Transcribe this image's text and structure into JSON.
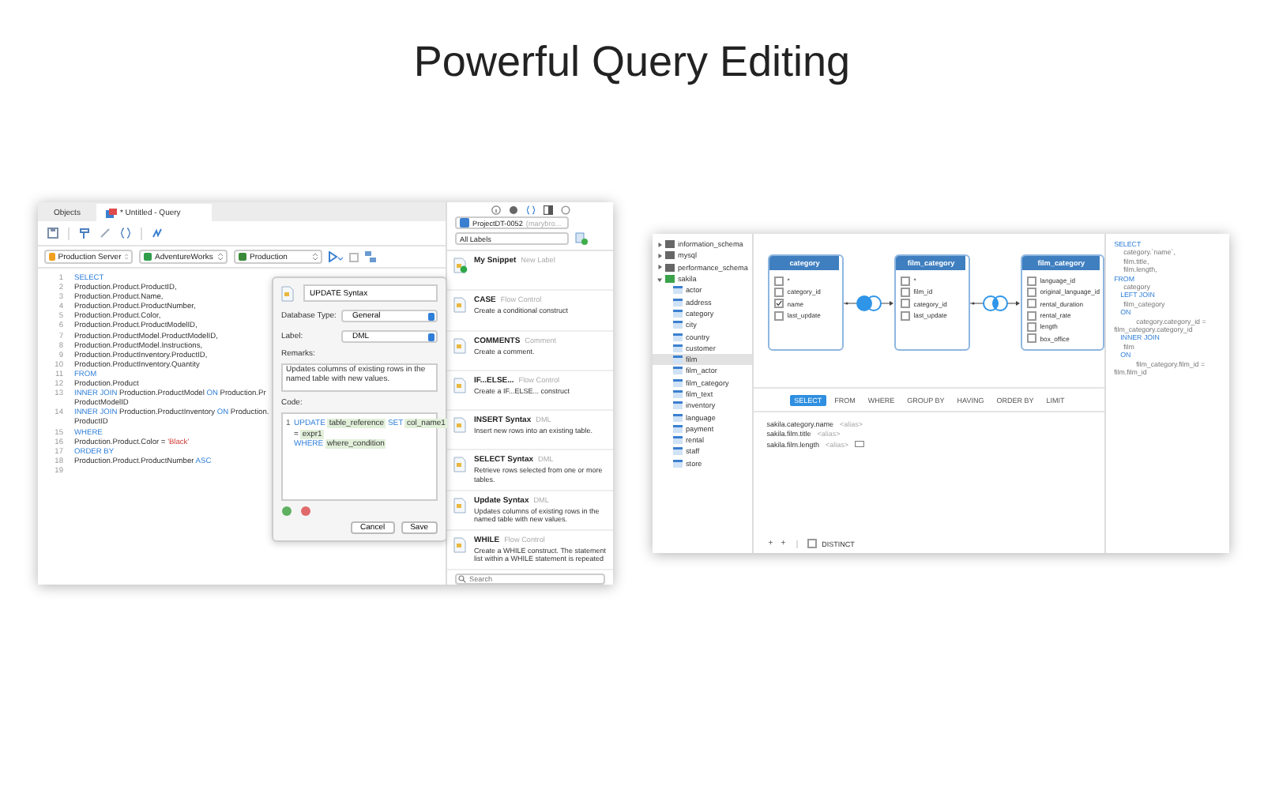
{
  "headline": "Powerful Query Editing",
  "query_window": {
    "tabs": [
      {
        "label": "Objects",
        "selected": false
      },
      {
        "label": "* Untitled - Query",
        "selected": true
      }
    ],
    "connection_selects": [
      {
        "label": "Production Server",
        "kind": "server"
      },
      {
        "label": "AdventureWorks",
        "kind": "database"
      },
      {
        "label": "Production",
        "kind": "schema"
      }
    ],
    "code_lines": [
      {
        "number": "1",
        "tokens": [
          {
            "text": "SELECT",
            "kind": "keyword"
          }
        ]
      },
      {
        "number": "2",
        "tokens": [
          {
            "text": "Production.Product.ProductID,",
            "kind": "plain"
          }
        ]
      },
      {
        "number": "3",
        "tokens": [
          {
            "text": "Production.Product.Name,",
            "kind": "plain"
          }
        ]
      },
      {
        "number": "4",
        "tokens": [
          {
            "text": "Production.Product.ProductNumber,",
            "kind": "plain"
          }
        ]
      },
      {
        "number": "5",
        "tokens": [
          {
            "text": "Production.Product.Color,",
            "kind": "plain"
          }
        ]
      },
      {
        "number": "6",
        "tokens": [
          {
            "text": "Production.Product.ProductModelID,",
            "kind": "plain"
          }
        ]
      },
      {
        "number": "7",
        "tokens": [
          {
            "text": "Production.ProductModel.ProductModelID,",
            "kind": "plain"
          }
        ]
      },
      {
        "number": "8",
        "tokens": [
          {
            "text": "Production.ProductModel.Instructions,",
            "kind": "plain"
          }
        ]
      },
      {
        "number": "9",
        "tokens": [
          {
            "text": "Production.ProductInventory.ProductID,",
            "kind": "plain"
          }
        ]
      },
      {
        "number": "10",
        "tokens": [
          {
            "text": "Production.ProductInventory.Quantity",
            "kind": "plain"
          }
        ]
      },
      {
        "number": "11",
        "tokens": [
          {
            "text": "FROM",
            "kind": "keyword"
          }
        ]
      },
      {
        "number": "12",
        "tokens": [
          {
            "text": "Production.Product",
            "kind": "plain"
          }
        ]
      },
      {
        "number": "13",
        "tokens": [
          {
            "text": "INNER JOIN",
            "kind": "keyword"
          },
          {
            "text": " Production.ProductModel ",
            "kind": "plain"
          },
          {
            "text": "ON",
            "kind": "keyword"
          },
          {
            "text": " Production.Pr",
            "kind": "plain"
          }
        ],
        "wrap": "ProductModelID"
      },
      {
        "number": "14",
        "tokens": [
          {
            "text": "INNER JOIN",
            "kind": "keyword"
          },
          {
            "text": " Production.ProductInventory ",
            "kind": "plain"
          },
          {
            "text": "ON",
            "kind": "keyword"
          },
          {
            "text": " Production.",
            "kind": "plain"
          }
        ],
        "wrap": "ProductID"
      },
      {
        "number": "15",
        "tokens": [
          {
            "text": "WHERE",
            "kind": "keyword"
          }
        ]
      },
      {
        "number": "16",
        "tokens": [
          {
            "text": "Production.Product.Color = ",
            "kind": "plain"
          },
          {
            "text": "'Black'",
            "kind": "string"
          }
        ]
      },
      {
        "number": "17",
        "tokens": [
          {
            "text": "ORDER BY",
            "kind": "keyword"
          }
        ]
      },
      {
        "number": "18",
        "tokens": [
          {
            "text": "Production.Product.ProductNumber ",
            "kind": "plain"
          },
          {
            "text": "ASC",
            "kind": "keyword"
          }
        ]
      },
      {
        "number": "19"
      }
    ],
    "snippet_editor": {
      "name": "UPDATE Syntax",
      "database_type": {
        "label": "Database Type:",
        "value": "General"
      },
      "label_field": {
        "label": "Label:",
        "value": "DML"
      },
      "remarks_label": "Remarks:",
      "remarks": "Updates columns of existing rows in the named table with new values.",
      "code_label": "Code:",
      "code_rows": [
        {
          "number": "1",
          "tokens": [
            {
              "text": "UPDATE",
              "kind": "keyword"
            },
            {
              "text": "table_reference",
              "kind": "placeholder"
            },
            {
              "text": "SET",
              "kind": "keyword"
            },
            {
              "text": "col_name1",
              "kind": "placeholder"
            }
          ]
        },
        {
          "tokens": [
            {
              "text": "=",
              "kind": "plain"
            },
            {
              "text": "expr1",
              "kind": "placeholder"
            }
          ]
        },
        {
          "tokens": [
            {
              "text": "WHERE",
              "kind": "keyword"
            },
            {
              "text": "where_condition",
              "kind": "placeholder"
            }
          ]
        }
      ],
      "buttons": [
        "Cancel",
        "Save"
      ]
    },
    "snippet_panel": {
      "project": "ProjectDT-0052",
      "project_owner": "(marybro...",
      "label_filter": "All Labels",
      "snippets": [
        {
          "name": "My Snippet",
          "label": "New Label",
          "kind": "user"
        },
        {
          "name": "CASE",
          "label": "Flow Control",
          "description": "Create a conditional construct",
          "kind": "builtin"
        },
        {
          "name": "COMMENTS",
          "label": "Comment",
          "description": "Create a comment.",
          "kind": "builtin"
        },
        {
          "name": "IF...ELSE...",
          "label": "Flow Control",
          "description": "Create a IF...ELSE... construct",
          "kind": "builtin"
        },
        {
          "name": "INSERT Syntax",
          "label": "DML",
          "description": "Insert new rows into an existing table.",
          "kind": "builtin"
        },
        {
          "name": "SELECT Syntax",
          "label": "DML",
          "description": "Retrieve rows selected from one or more tables.",
          "kind": "builtin"
        },
        {
          "name": "Update Syntax",
          "label": "DML",
          "description": "Updates columns of existing rows in the named table with new values.",
          "kind": "builtin"
        },
        {
          "name": "WHILE",
          "label": "Flow Control",
          "description": "Create a WHILE construct. The statement list within a WHILE statement is repeated",
          "kind": "builtin"
        }
      ],
      "search_placeholder": "Search"
    }
  },
  "designer_window": {
    "tree": [
      {
        "name": "information_schema",
        "expanded": false,
        "selected": false
      },
      {
        "name": "mysql",
        "expanded": false,
        "selected": false
      },
      {
        "name": "performance_schema",
        "expanded": false,
        "selected": false
      },
      {
        "name": "sakila",
        "expanded": true,
        "selected": false,
        "children": [
          {
            "name": "actor",
            "selected": false
          },
          {
            "name": "address",
            "selected": false
          },
          {
            "name": "category",
            "selected": false
          },
          {
            "name": "city",
            "selected": false
          },
          {
            "name": "country",
            "selected": false
          },
          {
            "name": "customer",
            "selected": false
          },
          {
            "name": "film",
            "selected": true
          },
          {
            "name": "film_actor",
            "selected": false
          },
          {
            "name": "film_category",
            "selected": false
          },
          {
            "name": "film_text",
            "selected": false
          },
          {
            "name": "inventory",
            "selected": false
          },
          {
            "name": "language",
            "selected": false
          },
          {
            "name": "payment",
            "selected": false
          },
          {
            "name": "rental",
            "selected": false
          },
          {
            "name": "staff",
            "selected": false
          },
          {
            "name": "store",
            "selected": false
          }
        ]
      }
    ],
    "tables": [
      {
        "name": "category",
        "fields": [
          {
            "name": "*",
            "checked": false
          },
          {
            "name": "category_id",
            "checked": false
          },
          {
            "name": "name",
            "checked": true
          },
          {
            "name": "last_update",
            "checked": false
          }
        ]
      },
      {
        "name": "film_category",
        "fields": [
          {
            "name": "*",
            "checked": false
          },
          {
            "name": "film_id",
            "checked": false
          },
          {
            "name": "category_id",
            "checked": false
          },
          {
            "name": "last_update",
            "checked": false
          }
        ]
      },
      {
        "name": "film_category",
        "fields": [
          {
            "name": "language_id",
            "checked": false
          },
          {
            "name": "original_language_id",
            "checked": false
          },
          {
            "name": "rental_duration",
            "checked": false
          },
          {
            "name": "rental_rate",
            "checked": false
          },
          {
            "name": "length",
            "checked": false
          },
          {
            "name": "box_office",
            "checked": false
          }
        ]
      }
    ],
    "joins": [
      {
        "kind": "left"
      },
      {
        "kind": "inner"
      }
    ],
    "clause_tabs": [
      {
        "label": "SELECT",
        "selected": true
      },
      {
        "label": "FROM",
        "selected": false
      },
      {
        "label": "WHERE",
        "selected": false
      },
      {
        "label": "GROUP BY",
        "selected": false
      },
      {
        "label": "HAVING",
        "selected": false
      },
      {
        "label": "ORDER BY",
        "selected": false
      },
      {
        "label": "LIMIT",
        "selected": false
      }
    ],
    "select_fields": [
      {
        "field": "sakila.category.name",
        "alias": "<alias>"
      },
      {
        "field": "sakila.film.title",
        "alias": "<alias>"
      },
      {
        "field": "sakila.film.length",
        "alias": "<alias>",
        "kind": "expression"
      }
    ],
    "field_buttons": [
      "+",
      "+"
    ],
    "distinct": {
      "label": "DISTINCT",
      "checked": false
    },
    "sql_lines": [
      {
        "text": "SELECT",
        "kind": "clause"
      },
      {
        "text": "category.`name`,",
        "kind": "item"
      },
      {
        "text": "film.title,",
        "kind": "item"
      },
      {
        "text": "film.length,",
        "kind": "item"
      },
      {
        "text": "FROM",
        "kind": "clause"
      },
      {
        "text": "category",
        "kind": "item"
      },
      {
        "text": "LEFT JOIN",
        "kind": "join"
      },
      {
        "text": "film_category",
        "kind": "item"
      },
      {
        "text": "ON",
        "kind": "join"
      },
      {
        "text": "category.category_id = film_category.category_id",
        "kind": "condition"
      },
      {
        "text": "INNER JOIN",
        "kind": "join"
      },
      {
        "text": "film",
        "kind": "item"
      },
      {
        "text": "ON",
        "kind": "join"
      },
      {
        "text": "film_category.film_id = film.film_id",
        "kind": "condition"
      }
    ]
  }
}
